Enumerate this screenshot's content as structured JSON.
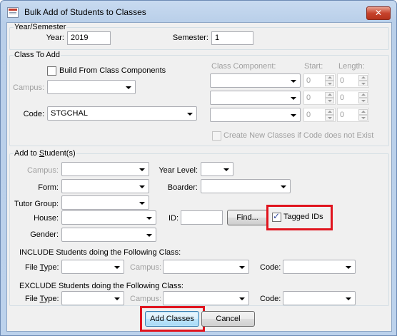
{
  "window": {
    "title": "Bulk Add of Students to Classes",
    "close_glyph": "✕"
  },
  "year_semester": {
    "legend": "Year/Semester",
    "year_label": "Year:",
    "year_value": "2019",
    "semester_label": "Semester:",
    "semester_value": "1"
  },
  "class_to_add": {
    "legend": "Class To Add",
    "build_label": "Build From Class Components",
    "campus_label": "Campus:",
    "campus_value": "",
    "code_label": "Code:",
    "code_value": "STGCHAL",
    "component_header": "Class Component:",
    "start_header": "Start:",
    "length_header": "Length:",
    "components": [
      {
        "value": "",
        "start": "0",
        "length": "0"
      },
      {
        "value": "",
        "start": "0",
        "length": "0"
      },
      {
        "value": "",
        "start": "0",
        "length": "0"
      }
    ],
    "create_new_label": "Create New Classes if Code does not Exist"
  },
  "add_to_students": {
    "legend_pre": "Add to ",
    "legend_u": "S",
    "legend_post": "tudent(s)",
    "campus_label": "Campus:",
    "campus_value": "",
    "year_level_label": "Year Level:",
    "year_level_value": "",
    "form_label": "Form:",
    "form_value": "",
    "boarder_label": "Boarder:",
    "boarder_value": "",
    "tutor_label": "Tutor Group:",
    "tutor_value": "",
    "house_label": "House:",
    "house_value": "",
    "id_label": "ID:",
    "id_value": "",
    "find_label": "Find...",
    "tagged_label": "Tagged IDs",
    "tagged_checked": true,
    "gender_label": "Gender:",
    "gender_value": "",
    "include_heading": "INCLUDE Students doing the Following Class:",
    "exclude_heading": "EXCLUDE Students doing the Following Class:",
    "file_type_pre": "File ",
    "file_type_u": "T",
    "file_type_post": "ype:",
    "campus2_label": "Campus:",
    "code2_label": "Code:"
  },
  "buttons": {
    "add_classes": "Add Classes",
    "cancel": "Cancel"
  },
  "highlight_color": "#e0141e"
}
